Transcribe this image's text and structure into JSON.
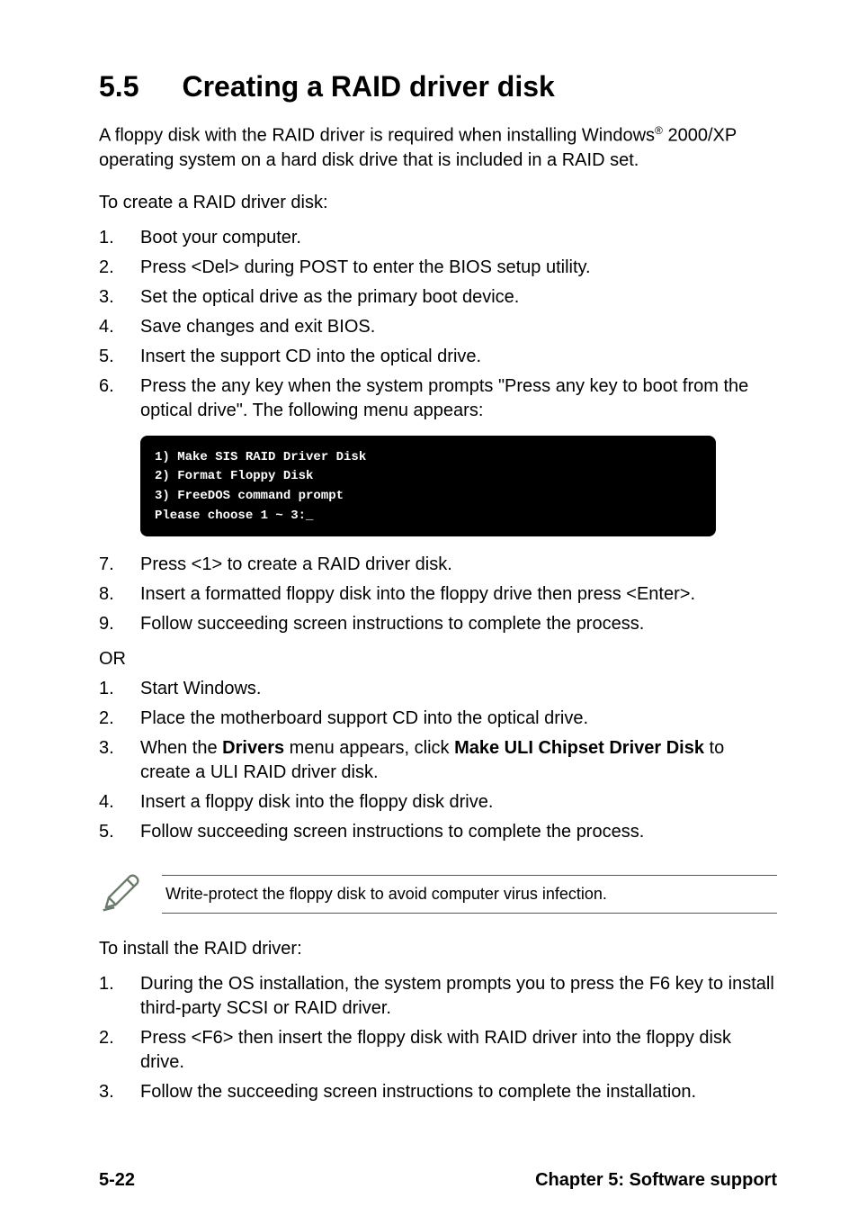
{
  "title": {
    "number": "5.5",
    "text": "Creating a RAID driver disk"
  },
  "intro_prefix": "A floppy disk with the RAID driver is required when installing Windows",
  "intro_reg": "®",
  "intro_suffix": " 2000/XP operating system on a hard disk drive that is included in a RAID set.",
  "lead1": "To create a RAID driver disk:",
  "steps1": [
    "Boot your computer.",
    "Press <Del> during POST to enter the BIOS setup utility.",
    "Set the optical drive as the primary boot device.",
    "Save changes and exit BIOS.",
    "Insert the support CD into the optical drive.",
    "Press the any key when the system prompts \"Press any key to boot from the optical drive\". The following menu appears:"
  ],
  "codebox": {
    "l1": "1) Make SIS RAID Driver Disk",
    "l2": "2) Format Floppy Disk",
    "l3": "3) FreeDOS command prompt",
    "l4": "Please choose 1 ~ 3:_"
  },
  "steps1b": [
    {
      "n": "7.",
      "t": "Press <1> to create a RAID driver disk."
    },
    {
      "n": "8.",
      "t": "Insert a formatted floppy disk into the floppy drive then press <Enter>."
    },
    {
      "n": "9.",
      "t": "Follow succeeding screen instructions to complete the process."
    }
  ],
  "or": "OR",
  "steps2": {
    "i1": "Start Windows.",
    "i2": "Place the motherboard support CD into the optical drive.",
    "i3_pre": "When the ",
    "i3_b1": "Drivers",
    "i3_mid": " menu appears, click ",
    "i3_b2": "Make ULI Chipset Driver Disk",
    "i3_post": " to create a ULI RAID driver disk.",
    "i4": "Insert a floppy disk into the floppy disk drive.",
    "i5": "Follow succeeding screen instructions to complete the process."
  },
  "note_text": "Write-protect the floppy disk to avoid computer virus infection.",
  "lead2": "To install the RAID driver:",
  "steps3": [
    "During the OS installation, the system prompts you to press the F6 key to install third-party SCSI or RAID driver.",
    "Press <F6> then insert the floppy disk with RAID driver into the floppy disk drive.",
    "Follow the succeeding screen instructions to complete the installation."
  ],
  "footer": {
    "left": "5-22",
    "right": "Chapter 5: Software support"
  }
}
